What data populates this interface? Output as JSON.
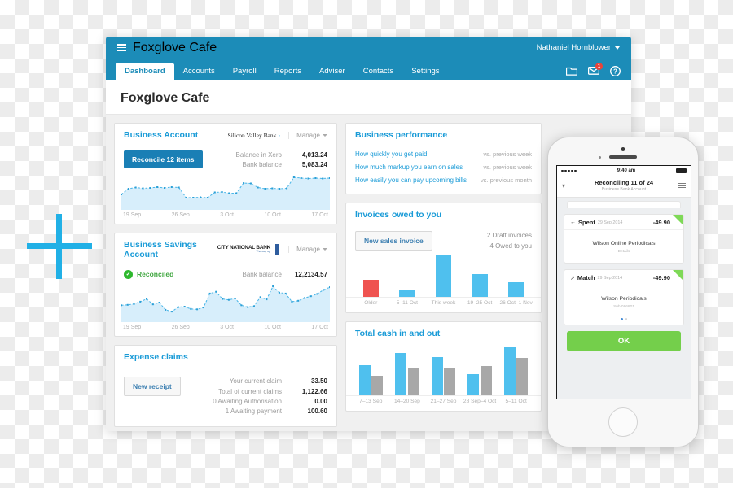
{
  "app": {
    "org_name": "Foxglove Cafe",
    "user_name": "Nathaniel Hornblower",
    "page_title": "Foxglove Cafe",
    "nav_tabs": [
      {
        "label": "Dashboard",
        "active": true
      },
      {
        "label": "Accounts",
        "active": false
      },
      {
        "label": "Payroll",
        "active": false
      },
      {
        "label": "Reports",
        "active": false
      },
      {
        "label": "Adviser",
        "active": false
      },
      {
        "label": "Contacts",
        "active": false
      },
      {
        "label": "Settings",
        "active": false
      }
    ],
    "icons": {
      "folder": "folder-icon",
      "messages": "envelope-icon",
      "messages_badge": "1",
      "help": "help-icon"
    },
    "colors": {
      "brand_blue": "#1c8cb8",
      "link_blue": "#1a9bd7",
      "chart_blue": "#4fc0ee",
      "chart_gray": "#a8a8a8",
      "chart_red": "#ef5350",
      "green": "#74cf4b"
    }
  },
  "business_account": {
    "title": "Business Account",
    "bank": "Silicon Valley Bank",
    "manage_label": "Manage",
    "reconcile_button": "Reconcile 12 items",
    "balances": [
      {
        "label": "Balance in Xero",
        "value": "4,013.24"
      },
      {
        "label": "Bank balance",
        "value": "5,083.24"
      }
    ],
    "axis": [
      "19 Sep",
      "26 Sep",
      "3 Oct",
      "10 Oct",
      "17 Oct"
    ],
    "sparkline": [
      30,
      44,
      47,
      45,
      46,
      48,
      46,
      48,
      47,
      22,
      22,
      23,
      22,
      35,
      36,
      33,
      33,
      58,
      57,
      47,
      44,
      45,
      44,
      45,
      72,
      70,
      69,
      70,
      69,
      70
    ]
  },
  "savings_account": {
    "title": "Business Savings Account",
    "bank_line1": "CITY NATIONAL BANK",
    "bank_line2": "The way up",
    "manage_label": "Manage",
    "status": "Reconciled",
    "balance_label": "Bank balance",
    "balance_value": "12,2134.57",
    "axis": [
      "19 Sep",
      "26 Sep",
      "3 Oct",
      "10 Oct",
      "17 Oct"
    ],
    "sparkline": [
      30,
      31,
      33,
      38,
      44,
      32,
      36,
      20,
      16,
      26,
      27,
      22,
      21,
      25,
      56,
      60,
      44,
      42,
      45,
      30,
      26,
      28,
      48,
      43,
      72,
      58,
      56,
      38,
      40,
      46,
      50,
      55,
      64,
      70
    ]
  },
  "expense_claims": {
    "title": "Expense claims",
    "new_receipt_button": "New receipt",
    "rows": [
      {
        "label": "Your current claim",
        "value": "33.50"
      },
      {
        "label": "Total of current claims",
        "value": "1,122.66"
      },
      {
        "label": "0 Awaiting Authorisation",
        "value": "0.00"
      },
      {
        "label": "1 Awaiting payment",
        "value": "100.60"
      }
    ]
  },
  "business_performance": {
    "title": "Business performance",
    "rows": [
      {
        "link": "How quickly you get paid",
        "vs": "vs. previous week"
      },
      {
        "link": "How much markup you earn on sales",
        "vs": "vs. previous week"
      },
      {
        "link": "How easily you can pay upcoming bills",
        "vs": "vs. previous month"
      }
    ]
  },
  "invoices_owed": {
    "title": "Invoices owed to you",
    "new_invoice_button": "New sales invoice",
    "meta": [
      "2 Draft invoices",
      "4 Owed to you"
    ],
    "chart_data": {
      "type": "bar",
      "title": "Invoices owed to you",
      "categories": [
        "Older",
        "5–11 Oct",
        "This week",
        "19–25 Oct",
        "26 Oct–1 Nov"
      ],
      "values": [
        22,
        8,
        56,
        30,
        19
      ],
      "colors": [
        "#ef5350",
        "#4fc0ee",
        "#4fc0ee",
        "#4fc0ee",
        "#4fc0ee"
      ],
      "xlabel": "",
      "ylabel": "",
      "ylim": [
        0,
        60
      ],
      "grid": false,
      "legend": "none"
    }
  },
  "cash_in_out": {
    "title": "Total cash in and out",
    "chart_data": {
      "type": "bar",
      "title": "Total cash in and out",
      "categories": [
        "7–13 Sep",
        "14–20 Sep",
        "21–27 Sep",
        "28 Sep–4 Oct",
        "5–11 Oct"
      ],
      "series": [
        {
          "name": "Cash in",
          "color": "#4fc0ee",
          "values": [
            44,
            62,
            56,
            30,
            70
          ]
        },
        {
          "name": "Cash out",
          "color": "#a8a8a8",
          "values": [
            28,
            40,
            40,
            42,
            54
          ]
        }
      ],
      "xlabel": "",
      "ylabel": "",
      "ylim": [
        0,
        75
      ],
      "grid": false,
      "legend": "none"
    }
  },
  "phone": {
    "status_time": "9:40 am",
    "nav_title": "Reconciling 11 of 24",
    "nav_subtitle": "Business Bank Account",
    "cards": [
      {
        "type_label": "Spent",
        "date": "29 Sep 2014",
        "amount": "-49.90",
        "name": "Wilson Online Periodicals",
        "sub": "Details"
      },
      {
        "type_label": "Match",
        "date": "29 Sep 2014",
        "amount": "-49.90",
        "name": "Wilson Periodicals",
        "sub": "Sub 096801"
      }
    ],
    "ok_button": "OK"
  }
}
